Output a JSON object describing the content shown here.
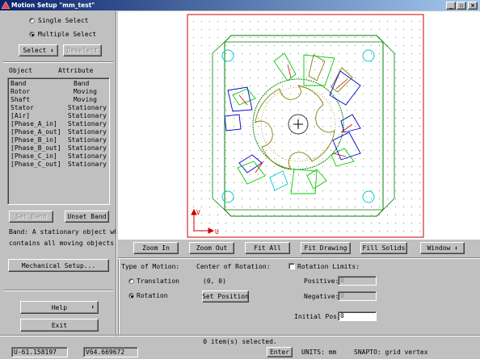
{
  "window": {
    "title": "Motion Setup \"mm_test\""
  },
  "select_mode": {
    "single_label": "Single Select",
    "multiple_label": "Multiple Select",
    "selected": "multiple"
  },
  "buttons": {
    "select": "Select",
    "deselect": "Deselect",
    "set_band": "Set Band",
    "unset_band": "Unset Band",
    "mechanical_setup": "Mechanical Setup...",
    "help": "Help",
    "exit": "Exit"
  },
  "object_list": {
    "headers": {
      "object": "Object",
      "attribute": "Attribute"
    },
    "rows": [
      {
        "object": "Band",
        "attribute": "Band"
      },
      {
        "object": "Rotor",
        "attribute": "Moving"
      },
      {
        "object": "Shaft",
        "attribute": "Moving"
      },
      {
        "object": "Stator",
        "attribute": "Stationary"
      },
      {
        "object": "[Air]",
        "attribute": "Stationary"
      },
      {
        "object": "[Phase_A_in]",
        "attribute": "Stationary"
      },
      {
        "object": "[Phase_A_out]",
        "attribute": "Stationary"
      },
      {
        "object": "[Phase_B_in]",
        "attribute": "Stationary"
      },
      {
        "object": "[Phase_B_out]",
        "attribute": "Stationary"
      },
      {
        "object": "[Phase_C_in]",
        "attribute": "Stationary"
      },
      {
        "object": "[Phase_C_out]",
        "attribute": "Stationary"
      }
    ]
  },
  "band_info": {
    "line1": "Band: A stationary object which",
    "line2": "contains all moving objects."
  },
  "toolbar": {
    "zoom_in": "Zoom In",
    "zoom_out": "Zoom Out",
    "fit_all": "Fit All",
    "fit_drawing": "Fit Drawing",
    "fill_solids": "Fill Solids",
    "window": "Window"
  },
  "motion": {
    "type_label": "Type of Motion:",
    "translation_label": "Translation",
    "rotation_label": "Rotation",
    "selected": "rotation",
    "center_label": "Center of Rotation:",
    "center_value": "(0, 0)",
    "set_position": "Set Position",
    "rotation_limits_label": "Rotation Limits:",
    "positive_label": "Positive:",
    "positive_value": "0",
    "negative_label": "Negative:",
    "negative_value": "0",
    "initial_pos_label": "Initial Pos:",
    "initial_pos_value": "0"
  },
  "status": {
    "selection": "0 item(s) selected.",
    "u_label": "U",
    "u_value": "-61.158197",
    "v_label": "V",
    "v_value": "64.669672",
    "enter": "Enter",
    "units": "UNITS: mm",
    "snap": "SNAPTO: grid vertex"
  },
  "canvas": {
    "axis_u": "U",
    "axis_v": "V"
  },
  "colors": {
    "title_start": "#0a246a",
    "title_end": "#a6caf0",
    "frame": "#cc0000",
    "stator": "#008000",
    "rotor": "#808000",
    "axis": "#cc0000",
    "hole": "#00cccc"
  }
}
